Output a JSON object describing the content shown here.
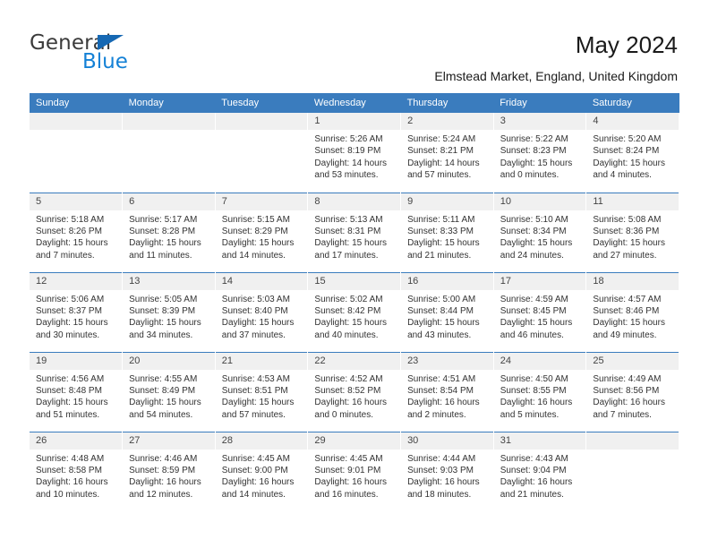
{
  "brand": {
    "name_top": "General",
    "name_bottom": "Blue",
    "accent_color": "#1481d6",
    "triangle_color": "#1668b3"
  },
  "header": {
    "title": "May 2024",
    "subtitle": "Elmstead Market, England, United Kingdom"
  },
  "theme": {
    "header_row_bg": "#3a7cbe",
    "daynum_band_bg": "#f0f0f0",
    "grid_line": "#3a7cbe",
    "text": "#333333"
  },
  "calendar": {
    "weekday_headers": [
      "Sunday",
      "Monday",
      "Tuesday",
      "Wednesday",
      "Thursday",
      "Friday",
      "Saturday"
    ],
    "weeks": [
      [
        {
          "day": "",
          "lines": []
        },
        {
          "day": "",
          "lines": []
        },
        {
          "day": "",
          "lines": []
        },
        {
          "day": "1",
          "lines": [
            "Sunrise: 5:26 AM",
            "Sunset: 8:19 PM",
            "Daylight: 14 hours",
            "and 53 minutes."
          ]
        },
        {
          "day": "2",
          "lines": [
            "Sunrise: 5:24 AM",
            "Sunset: 8:21 PM",
            "Daylight: 14 hours",
            "and 57 minutes."
          ]
        },
        {
          "day": "3",
          "lines": [
            "Sunrise: 5:22 AM",
            "Sunset: 8:23 PM",
            "Daylight: 15 hours",
            "and 0 minutes."
          ]
        },
        {
          "day": "4",
          "lines": [
            "Sunrise: 5:20 AM",
            "Sunset: 8:24 PM",
            "Daylight: 15 hours",
            "and 4 minutes."
          ]
        }
      ],
      [
        {
          "day": "5",
          "lines": [
            "Sunrise: 5:18 AM",
            "Sunset: 8:26 PM",
            "Daylight: 15 hours",
            "and 7 minutes."
          ]
        },
        {
          "day": "6",
          "lines": [
            "Sunrise: 5:17 AM",
            "Sunset: 8:28 PM",
            "Daylight: 15 hours",
            "and 11 minutes."
          ]
        },
        {
          "day": "7",
          "lines": [
            "Sunrise: 5:15 AM",
            "Sunset: 8:29 PM",
            "Daylight: 15 hours",
            "and 14 minutes."
          ]
        },
        {
          "day": "8",
          "lines": [
            "Sunrise: 5:13 AM",
            "Sunset: 8:31 PM",
            "Daylight: 15 hours",
            "and 17 minutes."
          ]
        },
        {
          "day": "9",
          "lines": [
            "Sunrise: 5:11 AM",
            "Sunset: 8:33 PM",
            "Daylight: 15 hours",
            "and 21 minutes."
          ]
        },
        {
          "day": "10",
          "lines": [
            "Sunrise: 5:10 AM",
            "Sunset: 8:34 PM",
            "Daylight: 15 hours",
            "and 24 minutes."
          ]
        },
        {
          "day": "11",
          "lines": [
            "Sunrise: 5:08 AM",
            "Sunset: 8:36 PM",
            "Daylight: 15 hours",
            "and 27 minutes."
          ]
        }
      ],
      [
        {
          "day": "12",
          "lines": [
            "Sunrise: 5:06 AM",
            "Sunset: 8:37 PM",
            "Daylight: 15 hours",
            "and 30 minutes."
          ]
        },
        {
          "day": "13",
          "lines": [
            "Sunrise: 5:05 AM",
            "Sunset: 8:39 PM",
            "Daylight: 15 hours",
            "and 34 minutes."
          ]
        },
        {
          "day": "14",
          "lines": [
            "Sunrise: 5:03 AM",
            "Sunset: 8:40 PM",
            "Daylight: 15 hours",
            "and 37 minutes."
          ]
        },
        {
          "day": "15",
          "lines": [
            "Sunrise: 5:02 AM",
            "Sunset: 8:42 PM",
            "Daylight: 15 hours",
            "and 40 minutes."
          ]
        },
        {
          "day": "16",
          "lines": [
            "Sunrise: 5:00 AM",
            "Sunset: 8:44 PM",
            "Daylight: 15 hours",
            "and 43 minutes."
          ]
        },
        {
          "day": "17",
          "lines": [
            "Sunrise: 4:59 AM",
            "Sunset: 8:45 PM",
            "Daylight: 15 hours",
            "and 46 minutes."
          ]
        },
        {
          "day": "18",
          "lines": [
            "Sunrise: 4:57 AM",
            "Sunset: 8:46 PM",
            "Daylight: 15 hours",
            "and 49 minutes."
          ]
        }
      ],
      [
        {
          "day": "19",
          "lines": [
            "Sunrise: 4:56 AM",
            "Sunset: 8:48 PM",
            "Daylight: 15 hours",
            "and 51 minutes."
          ]
        },
        {
          "day": "20",
          "lines": [
            "Sunrise: 4:55 AM",
            "Sunset: 8:49 PM",
            "Daylight: 15 hours",
            "and 54 minutes."
          ]
        },
        {
          "day": "21",
          "lines": [
            "Sunrise: 4:53 AM",
            "Sunset: 8:51 PM",
            "Daylight: 15 hours",
            "and 57 minutes."
          ]
        },
        {
          "day": "22",
          "lines": [
            "Sunrise: 4:52 AM",
            "Sunset: 8:52 PM",
            "Daylight: 16 hours",
            "and 0 minutes."
          ]
        },
        {
          "day": "23",
          "lines": [
            "Sunrise: 4:51 AM",
            "Sunset: 8:54 PM",
            "Daylight: 16 hours",
            "and 2 minutes."
          ]
        },
        {
          "day": "24",
          "lines": [
            "Sunrise: 4:50 AM",
            "Sunset: 8:55 PM",
            "Daylight: 16 hours",
            "and 5 minutes."
          ]
        },
        {
          "day": "25",
          "lines": [
            "Sunrise: 4:49 AM",
            "Sunset: 8:56 PM",
            "Daylight: 16 hours",
            "and 7 minutes."
          ]
        }
      ],
      [
        {
          "day": "26",
          "lines": [
            "Sunrise: 4:48 AM",
            "Sunset: 8:58 PM",
            "Daylight: 16 hours",
            "and 10 minutes."
          ]
        },
        {
          "day": "27",
          "lines": [
            "Sunrise: 4:46 AM",
            "Sunset: 8:59 PM",
            "Daylight: 16 hours",
            "and 12 minutes."
          ]
        },
        {
          "day": "28",
          "lines": [
            "Sunrise: 4:45 AM",
            "Sunset: 9:00 PM",
            "Daylight: 16 hours",
            "and 14 minutes."
          ]
        },
        {
          "day": "29",
          "lines": [
            "Sunrise: 4:45 AM",
            "Sunset: 9:01 PM",
            "Daylight: 16 hours",
            "and 16 minutes."
          ]
        },
        {
          "day": "30",
          "lines": [
            "Sunrise: 4:44 AM",
            "Sunset: 9:03 PM",
            "Daylight: 16 hours",
            "and 18 minutes."
          ]
        },
        {
          "day": "31",
          "lines": [
            "Sunrise: 4:43 AM",
            "Sunset: 9:04 PM",
            "Daylight: 16 hours",
            "and 21 minutes."
          ]
        },
        {
          "day": "",
          "lines": []
        }
      ]
    ]
  }
}
